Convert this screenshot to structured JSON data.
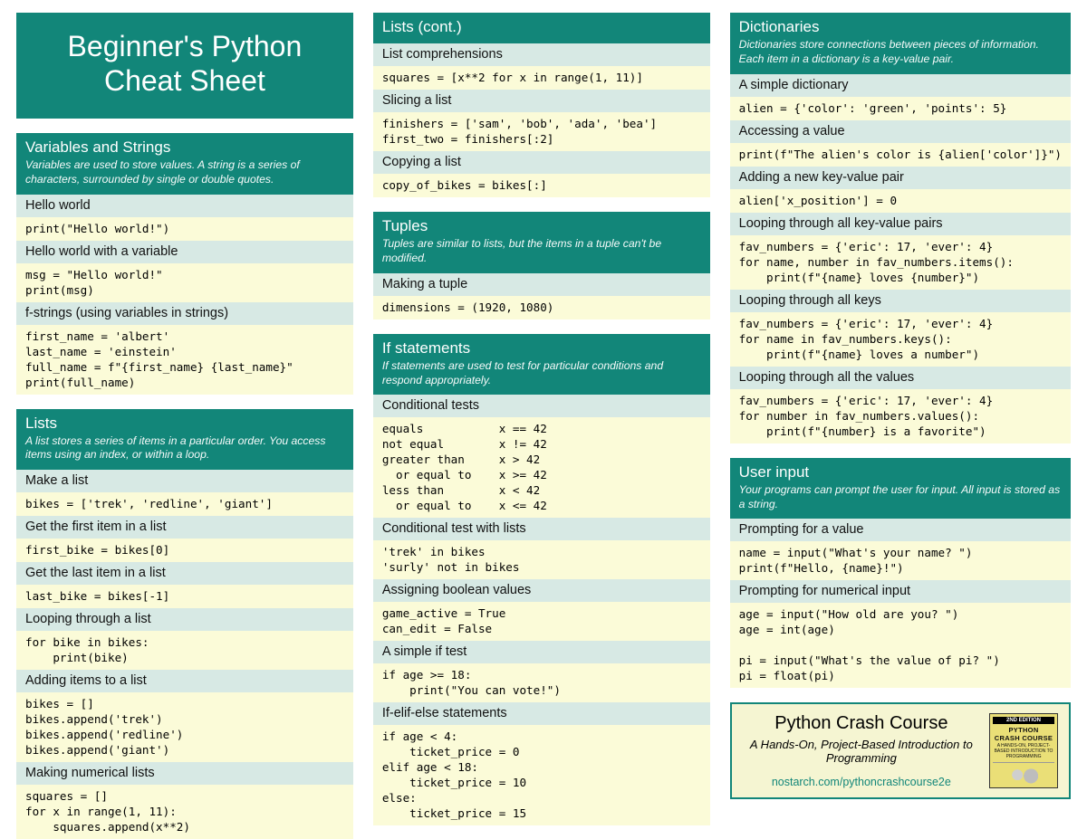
{
  "title_line1": "Beginner's Python",
  "title_line2": "Cheat Sheet",
  "col1": {
    "vars": {
      "title": "Variables and Strings",
      "desc": "Variables are used to store values. A string is a series of characters, surrounded by single or double quotes.",
      "s1": "Hello world",
      "c1": "print(\"Hello world!\")",
      "s2": "Hello world with a variable",
      "c2": "msg = \"Hello world!\"\nprint(msg)",
      "s3": "f-strings (using variables in strings)",
      "c3": "first_name = 'albert'\nlast_name = 'einstein'\nfull_name = f\"{first_name} {last_name}\"\nprint(full_name)"
    },
    "lists": {
      "title": "Lists",
      "desc": "A list stores a series of items in a particular order. You access items using an index, or within a loop.",
      "s1": "Make a list",
      "c1": "bikes = ['trek', 'redline', 'giant']",
      "s2": "Get the first item in a list",
      "c2": "first_bike = bikes[0]",
      "s3": "Get the last item in a list",
      "c3": "last_bike = bikes[-1]",
      "s4": "Looping through a list",
      "c4": "for bike in bikes:\n    print(bike)",
      "s5": "Adding items to a list",
      "c5": "bikes = []\nbikes.append('trek')\nbikes.append('redline')\nbikes.append('giant')",
      "s6": "Making numerical lists",
      "c6": "squares = []\nfor x in range(1, 11):\n    squares.append(x**2)"
    }
  },
  "col2": {
    "listscont": {
      "title": "Lists (cont.)",
      "s1": "List comprehensions",
      "c1": "squares = [x**2 for x in range(1, 11)]",
      "s2": "Slicing a list",
      "c2": "finishers = ['sam', 'bob', 'ada', 'bea']\nfirst_two = finishers[:2]",
      "s3": "Copying a list",
      "c3": "copy_of_bikes = bikes[:]"
    },
    "tuples": {
      "title": "Tuples",
      "desc": "Tuples are similar to lists, but the items in a tuple can't be modified.",
      "s1": "Making a tuple",
      "c1": "dimensions = (1920, 1080)"
    },
    "ifs": {
      "title": "If statements",
      "desc": "If statements are used to test for particular conditions and respond appropriately.",
      "s1": "Conditional tests",
      "c1": "equals           x == 42\nnot equal        x != 42\ngreater than     x > 42\n  or equal to    x >= 42\nless than        x < 42\n  or equal to    x <= 42",
      "s2": "Conditional test with lists",
      "c2": "'trek' in bikes\n'surly' not in bikes",
      "s3": "Assigning boolean values",
      "c3": "game_active = True\ncan_edit = False",
      "s4": "A simple if test",
      "c4": "if age >= 18:\n    print(\"You can vote!\")",
      "s5": "If-elif-else statements",
      "c5": "if age < 4:\n    ticket_price = 0\nelif age < 18:\n    ticket_price = 10\nelse:\n    ticket_price = 15"
    }
  },
  "col3": {
    "dicts": {
      "title": "Dictionaries",
      "desc": "Dictionaries store connections between pieces of information. Each item in a dictionary is a key-value pair.",
      "s1": "A simple dictionary",
      "c1": "alien = {'color': 'green', 'points': 5}",
      "s2": "Accessing a value",
      "c2": "print(f\"The alien's color is {alien['color']}\")",
      "s3": "Adding a new key-value pair",
      "c3": "alien['x_position'] = 0",
      "s4": "Looping through all key-value pairs",
      "c4": "fav_numbers = {'eric': 17, 'ever': 4}\nfor name, number in fav_numbers.items():\n    print(f\"{name} loves {number}\")",
      "s5": "Looping through all keys",
      "c5": "fav_numbers = {'eric': 17, 'ever': 4}\nfor name in fav_numbers.keys():\n    print(f\"{name} loves a number\")",
      "s6": "Looping through all the values",
      "c6": "fav_numbers = {'eric': 17, 'ever': 4}\nfor number in fav_numbers.values():\n    print(f\"{number} is a favorite\")"
    },
    "input": {
      "title": "User input",
      "desc": "Your programs can prompt the user for input. All input is stored as a string.",
      "s1": "Prompting for a value",
      "c1": "name = input(\"What's your name? \")\nprint(f\"Hello, {name}!\")",
      "s2": "Prompting for numerical input",
      "c2": "age = input(\"How old are you? \")\nage = int(age)\n\npi = input(\"What's the value of pi? \")\npi = float(pi)"
    }
  },
  "promo": {
    "title": "Python Crash Course",
    "sub": "A Hands-On, Project-Based Introduction to Programming",
    "link": "nostarch.com/pythoncrashcourse2e",
    "book_top": "2ND EDITION",
    "book_t1": "PYTHON",
    "book_t2": "CRASH COURSE",
    "book_t3": "A HANDS-ON, PROJECT-BASED INTRODUCTION TO PROGRAMMING"
  }
}
